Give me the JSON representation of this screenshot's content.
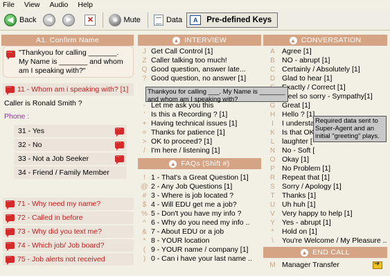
{
  "menu": [
    "File",
    "View",
    "Audio",
    "Help"
  ],
  "toolbar": {
    "back": "Back",
    "mute": "Mute",
    "data": "Data",
    "predefined_keys": "Pre-defined Keys"
  },
  "left": {
    "header": "A1. Confirm Name",
    "script_text": "\"Thankyou for calling _______. My Name is _______ and whom am I speaking with?\"",
    "question_11": "11 - Whom am i speaking with? [1]",
    "caller_line": "Caller is Ronald Smith ?",
    "phone_label": "Phone :",
    "options": [
      "31 - Yes",
      "32 - No",
      "33 - Not a Job Seeker",
      "34 - Friend / Family Member"
    ],
    "questions": [
      "71 - Why need my name?",
      "72 - Called in before",
      "73 - Why did you text me?",
      "74 - Which job/ Job board?",
      "75 - Job alerts not received"
    ]
  },
  "interview": {
    "header": "INTERVIEW",
    "items": [
      {
        "key": "J",
        "text": "Get Call Control [1]"
      },
      {
        "key": "Z",
        "text": "Caller talking too much!"
      },
      {
        "key": "Q",
        "text": "Good question, answer late..."
      },
      {
        "key": "?",
        "text": "Good question, no answer [1]"
      },
      {
        "key": "",
        "text": ""
      },
      {
        "key": "",
        "text": ""
      },
      {
        "key": "-",
        "text": "Let me ask you this"
      },
      {
        "key": "'",
        "text": "Is this a Recording ? [1]"
      },
      {
        "key": "+",
        "text": "Having technical issues [1]"
      },
      {
        "key": "=",
        "text": "Thanks for patience [1]"
      },
      {
        "key": ">",
        "text": "OK to proceed? [1]"
      },
      {
        "key": "/",
        "text": "I'm here / listening [1]"
      }
    ]
  },
  "faqs": {
    "header": "FAQs (Shift #)",
    "items": [
      {
        "key": "!",
        "text": "1 - That's a Great Question [1]"
      },
      {
        "key": "@",
        "text": "2 - Any Job Questions [1]"
      },
      {
        "key": "#",
        "text": "3 - Where is job located ?"
      },
      {
        "key": "$",
        "text": "4 - Will EDU get me a job?"
      },
      {
        "key": "%",
        "text": "5 - Don't you have my info ?"
      },
      {
        "key": "^",
        "text": "6 - Why do you need my info .."
      },
      {
        "key": "&",
        "text": "7 - About EDU or a job"
      },
      {
        "key": "*",
        "text": "8 - YOUR location"
      },
      {
        "key": "(",
        "text": "9 - YOUR name / company [1]"
      },
      {
        "key": ")",
        "text": "0 - Can i have your last name .."
      }
    ]
  },
  "conversation": {
    "header": "CONVERSATION",
    "items": [
      {
        "key": "A",
        "text": "Agree [1]"
      },
      {
        "key": "B",
        "text": "NO - abrupt [1]"
      },
      {
        "key": "C",
        "text": "Certainly / Absolutely [1]"
      },
      {
        "key": "D",
        "text": "Glad to hear [1]"
      },
      {
        "key": "E",
        "text": "Exactly / Correct [1]"
      },
      {
        "key": "F",
        "text": "I feel so sorry - Sympathy[1]"
      },
      {
        "key": "G",
        "text": "Great [1]"
      },
      {
        "key": "H",
        "text": "Hello ? [1]"
      },
      {
        "key": "I",
        "text": "I understand"
      },
      {
        "key": "K",
        "text": "Is that OK"
      },
      {
        "key": "L",
        "text": "laughter ["
      },
      {
        "key": "N",
        "text": "No - Soft ["
      },
      {
        "key": "O",
        "text": "Okay [1]"
      },
      {
        "key": "P",
        "text": "No Problem [1]"
      },
      {
        "key": "R",
        "text": "Repeat that [1]"
      },
      {
        "key": "S",
        "text": "Sorry / Apology [1]"
      },
      {
        "key": "T",
        "text": "Thanks [1]"
      },
      {
        "key": "U",
        "text": "Uh huh [1]"
      },
      {
        "key": "V",
        "text": "Very happy to help [1]"
      },
      {
        "key": "Y",
        "text": "Yes - abrupt [1]"
      },
      {
        "key": "*",
        "text": "Hold on  [1]"
      },
      {
        "key": "\\",
        "text": "You're Welcome / My Pleasure .."
      }
    ]
  },
  "endcall": {
    "header": "END CALL",
    "key": "M",
    "text": "Manager Transfer"
  },
  "tooltips": {
    "script": "Thankyou for calling ___. My Name is _______ and whom am I speaking with?",
    "agent": "Required data sent to Super-Agent and an initial \"greeting\" plays."
  }
}
